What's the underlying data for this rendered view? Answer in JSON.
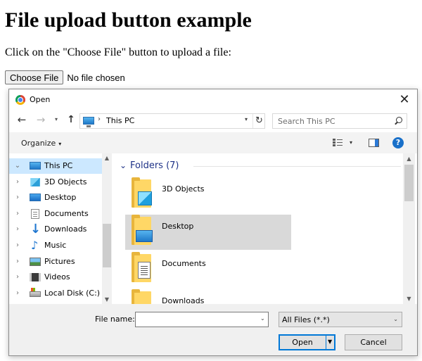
{
  "page": {
    "title": "File upload button example",
    "intro": "Click on the \"Choose File\" button to upload a file:",
    "choose_file_label": "Choose File",
    "no_file_text": "No file chosen"
  },
  "dialog": {
    "title": "Open",
    "close_glyph": "✕",
    "nav": {
      "back_glyph": "←",
      "forward_glyph": "→",
      "recent_glyph": "▾",
      "up_glyph": "↑",
      "address_sep": "›",
      "address_text": "This PC",
      "address_dropdown": "▾",
      "refresh_glyph": "↻",
      "search_placeholder": "Search This PC"
    },
    "commandbar": {
      "organize_label": "Organize",
      "organize_caret": "▾",
      "view_caret": "▾",
      "help_glyph": "?"
    },
    "tree": {
      "chevron_scroll_up": "▲",
      "chevron_scroll_down": "▼",
      "items": [
        {
          "label": "This PC",
          "chevron": "⌄",
          "icon": "this-pc-icon",
          "selected": true
        },
        {
          "label": "3D Objects",
          "chevron": "›",
          "icon": "3d-objects-icon"
        },
        {
          "label": "Desktop",
          "chevron": "›",
          "icon": "desktop-icon"
        },
        {
          "label": "Documents",
          "chevron": "›",
          "icon": "documents-icon"
        },
        {
          "label": "Downloads",
          "chevron": "›",
          "icon": "downloads-icon"
        },
        {
          "label": "Music",
          "chevron": "›",
          "icon": "music-icon"
        },
        {
          "label": "Pictures",
          "chevron": "›",
          "icon": "pictures-icon"
        },
        {
          "label": "Videos",
          "chevron": "›",
          "icon": "videos-icon"
        },
        {
          "label": "Local Disk (C:)",
          "chevron": "›",
          "icon": "local-disk-icon"
        }
      ]
    },
    "main": {
      "group_chevron": "⌄",
      "group_label": "Folders (7)",
      "scroll_up": "▲",
      "scroll_down": "▼",
      "folders": [
        {
          "name": "3D Objects",
          "badge": "3d-objects"
        },
        {
          "name": "Desktop",
          "badge": "desktop",
          "hover": true
        },
        {
          "name": "Documents",
          "badge": "documents"
        },
        {
          "name": "Downloads",
          "badge": "downloads"
        }
      ]
    },
    "footer": {
      "filename_label": "File name:",
      "filename_value": "",
      "filename_caret": "⌄",
      "filter_value": "All Files (*.*)",
      "filter_caret": "⌄",
      "open_label": "Open",
      "open_arrow": "▼",
      "cancel_label": "Cancel"
    }
  },
  "colors": {
    "selection": "#cce8ff",
    "hover": "#d9d9d9",
    "accent": "#0078d7",
    "group_header": "#1e3287"
  }
}
